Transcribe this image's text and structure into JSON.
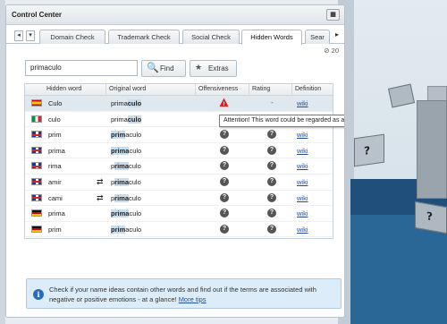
{
  "window": {
    "title": "Control Center",
    "counter": "20"
  },
  "tabs": [
    {
      "label": "Domain Check"
    },
    {
      "label": "Trademark Check"
    },
    {
      "label": "Social Check"
    },
    {
      "label": "Hidden Words",
      "active": true
    },
    {
      "label": "Sear"
    }
  ],
  "search": {
    "value": "primaculo",
    "find_label": "Find",
    "extras_label": "Extras"
  },
  "table": {
    "columns": [
      "Hidden word",
      "Original word",
      "Offensiveness",
      "Rating",
      "Definition"
    ],
    "rows": [
      {
        "flag": "es",
        "hidden": "Culo",
        "orig_pre": "prima",
        "orig_hl": "culo",
        "orig_post": "",
        "offense": "warning",
        "rating": "-",
        "def": "wiki",
        "selected": true
      },
      {
        "flag": "it",
        "hidden": "culo",
        "orig_pre": "prima",
        "orig_hl": "culo",
        "orig_post": "",
        "offense": "warning",
        "rating": "",
        "def": "wiki"
      },
      {
        "flag": "gb",
        "hidden": "prim",
        "orig_pre": "",
        "orig_hl": "prim",
        "orig_post": "aculo",
        "offense": "unknown",
        "rating": "unknown",
        "def": "wiki"
      },
      {
        "flag": "gb",
        "hidden": "prima",
        "orig_pre": "",
        "orig_hl": "prima",
        "orig_post": "culo",
        "offense": "unknown",
        "rating": "unknown",
        "def": "wiki"
      },
      {
        "flag": "gb",
        "hidden": "rima",
        "orig_pre": "p",
        "orig_hl": "rima",
        "orig_post": "culo",
        "offense": "unknown",
        "rating": "unknown",
        "def": "wiki"
      },
      {
        "flag": "gb",
        "hidden": "amir",
        "swap": true,
        "orig_pre": "p",
        "orig_hl": "rima",
        "orig_post": "culo",
        "offense": "unknown",
        "rating": "unknown",
        "def": "wiki"
      },
      {
        "flag": "gb",
        "hidden": "cami",
        "swap": true,
        "orig_pre": "p",
        "orig_hl": "rima",
        "orig_post": "culo",
        "offense": "unknown",
        "rating": "unknown",
        "def": "wiki"
      },
      {
        "flag": "de",
        "hidden": "prima",
        "orig_pre": "",
        "orig_hl": "prima",
        "orig_post": "culo",
        "offense": "unknown",
        "rating": "unknown",
        "def": "wiki"
      },
      {
        "flag": "de",
        "hidden": "prim",
        "orig_pre": "",
        "orig_hl": "prim",
        "orig_post": "aculo",
        "offense": "unknown",
        "rating": "unknown",
        "def": "wiki"
      }
    ]
  },
  "tooltip": "Attention! This word could be regarded as an offensive or negative term.",
  "info": {
    "text": "Check if your name ideas contain other words and find out if the terms are associated with negative or positive emotions - at a glance!",
    "link": "More tips"
  },
  "icons": {
    "warning_color": "#e02020",
    "question_color": "#555555",
    "info_color": "#2a6fb3"
  }
}
